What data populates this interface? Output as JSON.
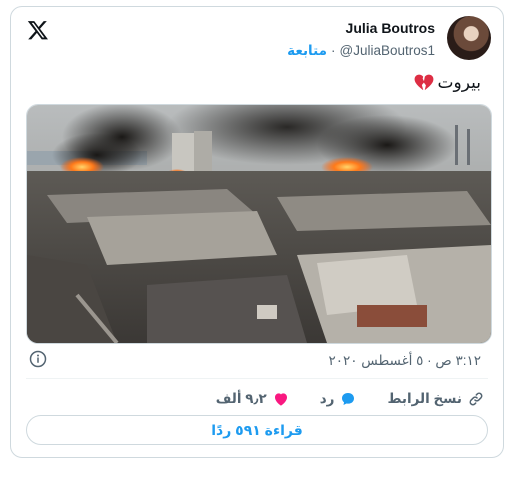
{
  "header": {
    "display_name": "Julia Boutros",
    "handle": "@JuliaBoutros1",
    "separator": "·",
    "follow_label": "متابعة"
  },
  "tweet": {
    "text": "بيروت",
    "emoji_icon": "broken-heart-icon",
    "timestamp": "٣:١٢ ص · ٥ أغسطس ٢٠٢٠"
  },
  "actions": {
    "like_count": "٩٫٢ ألف",
    "reply_label": "رد",
    "copy_link_label": "نسخ الرابط"
  },
  "footer": {
    "read_replies_label": "قراءة ٥٩١ ردًا"
  },
  "colors": {
    "accent": "#1d9bf0",
    "like": "#f91880",
    "text": "#0f1419",
    "muted": "#536471"
  }
}
